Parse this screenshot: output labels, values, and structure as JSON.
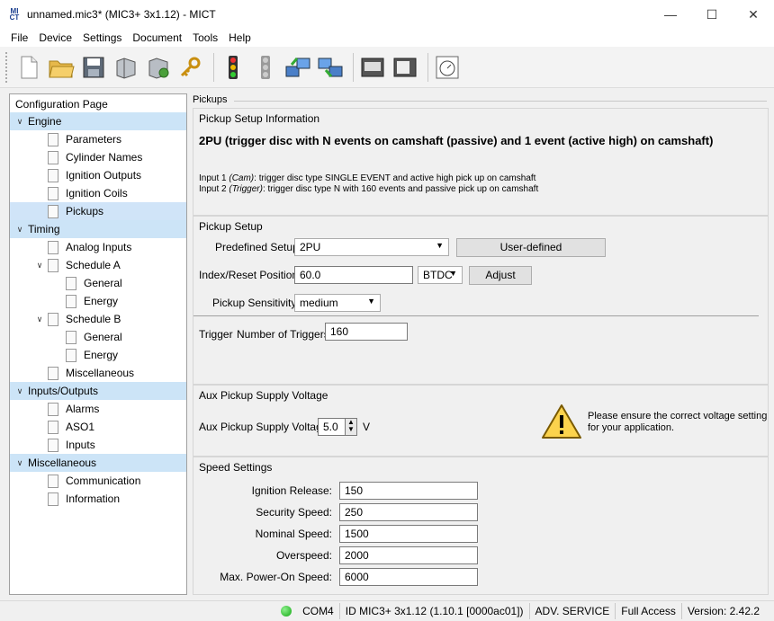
{
  "window": {
    "title": "unnamed.mic3* (MIC3+ 3x1.12) - MICT",
    "app_icon_text": "MI CT"
  },
  "menu": [
    "File",
    "Device",
    "Settings",
    "Document",
    "Tools",
    "Help"
  ],
  "toolbar_icons": [
    "new-document-icon",
    "open-folder-icon",
    "save-icon",
    "device-icon",
    "device-settings-icon",
    "key-icon",
    "traffic-light-icon",
    "traffic-light-off-icon",
    "transfer-up-icon",
    "transfer-down-icon",
    "monitor-icon",
    "screen-icon",
    "gauge-icon"
  ],
  "tree": {
    "title": "Configuration Page",
    "items": [
      {
        "label": "Engine",
        "level": 0,
        "section": true
      },
      {
        "label": "Parameters",
        "level": 1
      },
      {
        "label": "Cylinder Names",
        "level": 1
      },
      {
        "label": "Ignition Outputs",
        "level": 1
      },
      {
        "label": "Ignition Coils",
        "level": 1
      },
      {
        "label": "Pickups",
        "level": 1,
        "selected": true
      },
      {
        "label": "Timing",
        "level": 0,
        "section": true
      },
      {
        "label": "Analog Inputs",
        "level": 1
      },
      {
        "label": "Schedule A",
        "level": 1,
        "expandable": true
      },
      {
        "label": "General",
        "level": 2
      },
      {
        "label": "Energy",
        "level": 2
      },
      {
        "label": "Schedule B",
        "level": 1,
        "expandable": true
      },
      {
        "label": "General",
        "level": 2
      },
      {
        "label": "Energy",
        "level": 2
      },
      {
        "label": "Miscellaneous",
        "level": 1
      },
      {
        "label": "Inputs/Outputs",
        "level": 0,
        "section": true
      },
      {
        "label": "Alarms",
        "level": 1
      },
      {
        "label": "ASO1",
        "level": 1
      },
      {
        "label": "Inputs",
        "level": 1
      },
      {
        "label": "Miscellaneous",
        "level": 0,
        "section": true
      },
      {
        "label": "Communication",
        "level": 1
      },
      {
        "label": "Information",
        "level": 1
      }
    ]
  },
  "pickups": {
    "label": "Pickups",
    "info": {
      "title": "Pickup Setup Information",
      "heading": "2PU (trigger disc with N events on camshaft (passive) and 1 event (active high) on camshaft)",
      "input1_prefix": "Input 1 ",
      "input1_tag": "(Cam)",
      "input1_rest": ": trigger disc type SINGLE EVENT and active high pick up on camshaft",
      "input2_prefix": "Input 2 ",
      "input2_tag": "(Trigger)",
      "input2_rest": ": trigger disc type N with 160 events and passive pick up on camshaft"
    },
    "setup": {
      "title": "Pickup Setup",
      "predefined_label": "Predefined Setup:",
      "predefined_value": "2PU",
      "user_defined_button": "User-defined",
      "index_label": "Index/Reset Position:",
      "index_value": "60.0",
      "index_unit": "BTDC",
      "adjust_button": "Adjust",
      "sensitivity_label": "Pickup Sensitivity:",
      "sensitivity_value": "medium",
      "trigger_label": "Trigger",
      "num_triggers_label": "Number of Triggers:",
      "num_triggers_value": "160"
    },
    "aux": {
      "title": "Aux Pickup Supply Voltage",
      "label": "Aux Pickup Supply Voltage:",
      "value": "5.0",
      "unit": "V",
      "warning_line1": "Please ensure the correct voltage setting",
      "warning_line2": "for your application."
    },
    "speed": {
      "title": "Speed Settings",
      "rows": [
        {
          "label": "Ignition Release:",
          "value": "150"
        },
        {
          "label": "Security Speed:",
          "value": "250"
        },
        {
          "label": "Nominal Speed:",
          "value": "1500"
        },
        {
          "label": "Overspeed:",
          "value": "2000"
        },
        {
          "label": "Max. Power-On Speed:",
          "value": "6000"
        }
      ]
    }
  },
  "status": {
    "port": "COM4",
    "device_id": "ID MIC3+ 3x1.12 (1.10.1 [0000ac01])",
    "service": "ADV. SERVICE",
    "access": "Full Access",
    "version": "Version: 2.42.2",
    "connected_color": "#11a811"
  }
}
